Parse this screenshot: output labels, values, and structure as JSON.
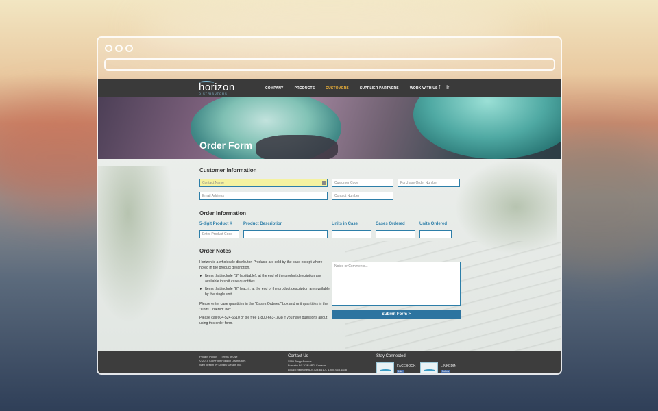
{
  "nav": {
    "logo": "horizon",
    "logo_sub": "DISTRIBUTORS",
    "menu": [
      "COMPANY",
      "PRODUCTS",
      "CUSTOMERS",
      "SUPPLIER PARTNERS",
      "WORK WITH US"
    ],
    "active_item": "CUSTOMERS",
    "social": [
      "f",
      "in"
    ]
  },
  "hero": {
    "title": "Order Form"
  },
  "customer_info": {
    "title": "Customer Information",
    "contact_name_placeholder": "Contact Name",
    "customer_code_placeholder": "Customer Code",
    "po_number_placeholder": "Purchase Order Number",
    "email_placeholder": "Email Address",
    "contact_number_placeholder": "Contact Number"
  },
  "order_info": {
    "title": "Order Information",
    "columns": [
      "5-digit Product #",
      "Product Description",
      "Units in Case",
      "Cases Ordered",
      "Units Ordered"
    ],
    "product_code_placeholder": "Enter Product Code"
  },
  "order_notes": {
    "title": "Order Notes",
    "intro": "Horizon is a wholesale distributor. Products are sold by the case except where noted in the product description.",
    "bullets": [
      "Items that include \"S\" (splittable), at the end of the product description are available in split case quantities.",
      "Items that include \"E\" (each), at the end of the product description are available by the single unit."
    ],
    "para2": "Please enter case quantities in the \"Cases Ordered\" box and unit quantities in the \"Units Ordered\" box.",
    "para3": "Please call 604-524-6610 or toll free 1-800-663-1838 if you have questions about using this order form.",
    "notes_placeholder": "Notes or Comments...",
    "submit_label": "Submit Form >"
  },
  "footer": {
    "privacy": "Privacy Policy",
    "terms": "Terms of Use",
    "copyright": "© 2015 Copyright Horizon Distributors",
    "web_design": "Web design by KIMBO Design Inc.",
    "contact_title": "Contact Us",
    "address1": "5589 Trapp Avenue",
    "address2": "Burnaby BC V3N 0B2, Canada",
    "phone": "Local Telephone 604.524.6610 - 1.800.663.1838",
    "stay_title": "Stay Connected",
    "facebook": "FACEBOOK",
    "linkedin": "LINKEDIN",
    "like": "Like",
    "follow": "Follow"
  }
}
